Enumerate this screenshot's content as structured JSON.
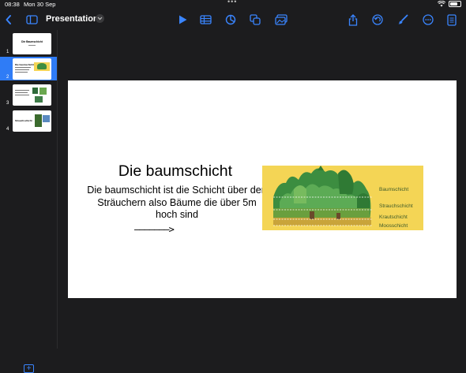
{
  "status": {
    "time": "08:38",
    "date": "Mon 30 Sep"
  },
  "toolbar": {
    "title": "Presentation"
  },
  "slides": [
    {
      "number": "1",
      "thumb_title": "Die Baumschicht"
    },
    {
      "number": "2",
      "thumb_title": "Die baumschicht"
    },
    {
      "number": "3"
    },
    {
      "number": "4",
      "thumb_title": "Strauchschicht"
    }
  ],
  "slide": {
    "title": "Die baumschicht",
    "body": "Die baumschicht ist die Schicht über den Sträuchern also Bäume die über 5m hoch sind",
    "arrow": "———————>",
    "diagram": {
      "labels": [
        "Baumschicht",
        "Strauchschicht",
        "Krautschicht",
        "Moosschicht"
      ],
      "colors": {
        "background": "#f4d555",
        "tree_dark": "#2e7d32",
        "tree_light": "#4caf50"
      }
    }
  },
  "colors": {
    "accent": "#2f7cf6",
    "chrome": "#1c1c1e"
  },
  "icons": [
    "back-icon",
    "sidebar-icon",
    "play-icon",
    "table-icon",
    "chart-icon",
    "shapes-icon",
    "media-icon",
    "share-icon",
    "undo-icon",
    "format-brush-icon",
    "more-icon",
    "document-icon",
    "add-slide-icon"
  ]
}
